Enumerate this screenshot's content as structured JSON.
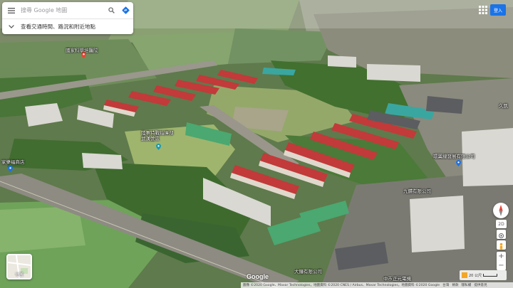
{
  "search": {
    "placeholder": "搜尋 Google 地圖",
    "subtitle": "查看交通時間、路況和附近地點"
  },
  "top_right": {
    "signin_label": "登入"
  },
  "layers": {
    "label": "地圖"
  },
  "controls": {
    "mode_label": "2D",
    "zoom_in": "+",
    "zoom_out": "−"
  },
  "branding": {
    "logo": "Google"
  },
  "footer": {
    "imagery": "圖像 ©2020 Google、Maxar Technologies，地圖資料 ©2020 CNES / Airbus、Maxar Technologies，地圖資料 ©2020 Google",
    "country": "台灣",
    "terms": "條款",
    "privacy": "隱私權",
    "feedback": "提供意見",
    "scale": "20 公尺"
  },
  "places": [
    {
      "name": "國家科學培醫院"
    },
    {
      "name": "陸軍特戰指揮部武漢營區"
    },
    {
      "name": "家樂福商店"
    },
    {
      "name": "環翼線發展有限公司"
    },
    {
      "name": "九鑽有限公司"
    },
    {
      "name": "大鐘有限公司"
    },
    {
      "name": "久凱"
    },
    {
      "name": "中市正元電機"
    }
  ],
  "colors": {
    "panel_bg": "#ffffff",
    "accent_blue": "#1a73e8",
    "pin_red": "#ea4335",
    "pin_teal": "#1a9bb0"
  }
}
